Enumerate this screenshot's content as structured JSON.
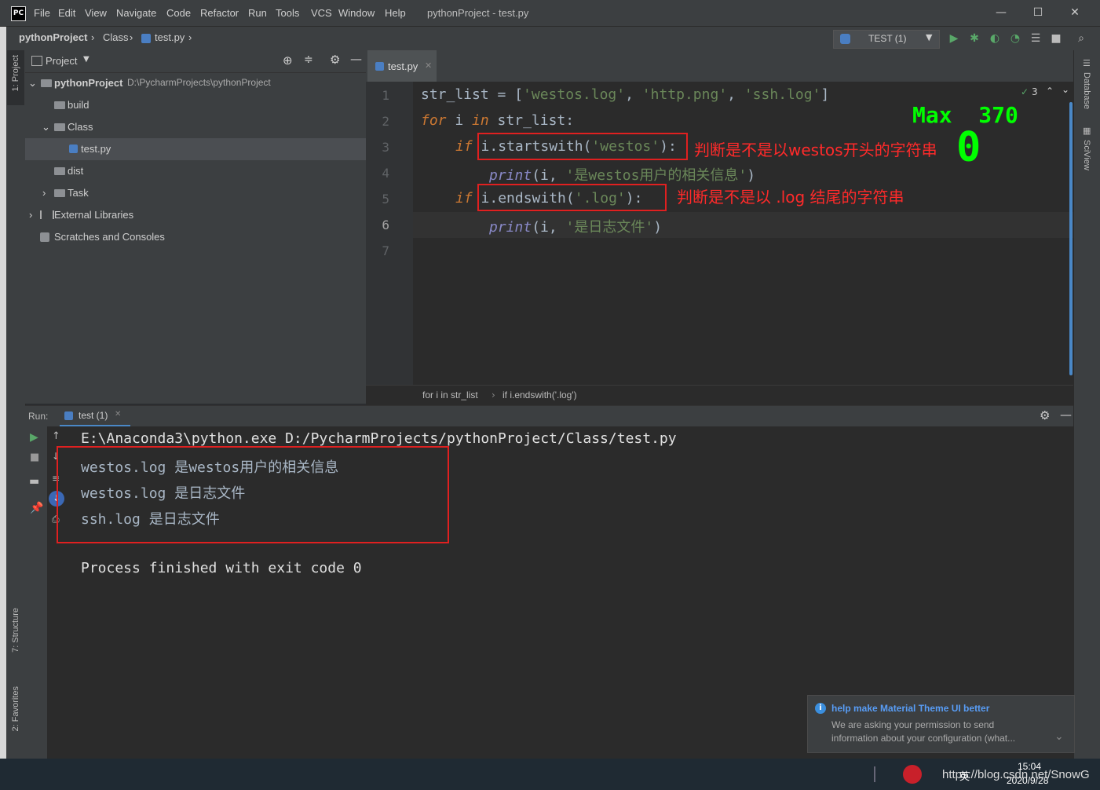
{
  "title_bar": {
    "logo": "PC",
    "menu": [
      "File",
      "Edit",
      "View",
      "Navigate",
      "Code",
      "Refactor",
      "Run",
      "Tools",
      "VCS",
      "Window",
      "Help"
    ],
    "window_title": "pythonProject - test.py",
    "controls": {
      "minimize": "—",
      "maximize": "☐",
      "close": "✕"
    }
  },
  "nav_bar": {
    "breadcrumbs": [
      "pythonProject",
      "Class",
      "test.py"
    ],
    "separator": "›",
    "run_config": "TEST (1)"
  },
  "left_stripe": {
    "top_tab": "1: Project",
    "structure_tab": "7: Structure",
    "favorites_tab": "2: Favorites"
  },
  "right_stripe": {
    "database_tab": "Database",
    "sciview_tab": "SciView"
  },
  "project_panel": {
    "title": "Project",
    "tree": [
      {
        "label": "pythonProject",
        "path": "D:\\PycharmProjects\\pythonProject",
        "level": 0,
        "arrow": "⌄",
        "type": "folder"
      },
      {
        "label": "build",
        "level": 1,
        "arrow": "",
        "type": "folder"
      },
      {
        "label": "Class",
        "level": 1,
        "arrow": "⌄",
        "type": "folder"
      },
      {
        "label": "test.py",
        "level": 2,
        "arrow": "",
        "type": "py",
        "selected": true
      },
      {
        "label": "dist",
        "level": 1,
        "arrow": "",
        "type": "folder"
      },
      {
        "label": "Task",
        "level": 1,
        "arrow": "›",
        "type": "folder"
      },
      {
        "label": "External Libraries",
        "level": 0,
        "arrow": "›",
        "type": "lib"
      },
      {
        "label": "Scratches and Consoles",
        "level": 0,
        "arrow": "",
        "type": "scratch"
      }
    ]
  },
  "editor": {
    "tab": "test.py",
    "inspection_count": "3",
    "max_overlay": "Max  370",
    "max_zero": "0",
    "line_numbers": [
      "1",
      "2",
      "3",
      "4",
      "5",
      "6",
      "7"
    ],
    "code": {
      "l1": {
        "a": "str_list = [",
        "s1": "'westos.log'",
        "c1": ", ",
        "s2": "'http.png'",
        "c2": ", ",
        "s3": "'ssh.log'",
        "e": "]"
      },
      "l2": {
        "kw1": "for",
        "a": " i ",
        "kw2": "in",
        "b": " str_list:"
      },
      "l3": {
        "kw": "if",
        "a": " i.startswith(",
        "s": "'westos'",
        "b": "):"
      },
      "l4": {
        "fn": "print",
        "a": "(i, ",
        "s": "'是westos用户的相关信息'",
        "b": ")"
      },
      "l5": {
        "kw": "if",
        "a": " i.endswith(",
        "s": "'.log'",
        "b": "):"
      },
      "l6": {
        "fn": "print",
        "a": "(i, ",
        "s": "'是日志文件'",
        "b": ")"
      }
    },
    "annotation_1": "判断是不是以westos开头的字符串",
    "annotation_2": "判断是不是以 .log 结尾的字符串",
    "breadcrumb": [
      "for i in str_list",
      "if i.endswith('.log')"
    ]
  },
  "run_panel": {
    "label": "Run:",
    "tab": "test (1)",
    "command": "E:\\Anaconda3\\python.exe D:/PycharmProjects/pythonProject/Class/test.py",
    "output": [
      "westos.log 是westos用户的相关信息",
      "westos.log 是日志文件",
      "ssh.log 是日志文件"
    ],
    "exit": "Process finished with exit code 0"
  },
  "notification": {
    "title": "help make Material Theme UI better",
    "body_1": "We are asking your permission to send",
    "body_2": "information about your configuration (what..."
  },
  "taskbar": {
    "time": "15:04",
    "date": "2020/9/28",
    "watermark": "https://blog.csdn.net/SnowG",
    "ime": "英"
  },
  "colors": {
    "keyword": "#cc7832",
    "string": "#6a8759",
    "builtin": "#8888c6",
    "annotation": "#ff2a2a",
    "overlay_green": "#00ff00",
    "link_blue": "#589df6"
  }
}
